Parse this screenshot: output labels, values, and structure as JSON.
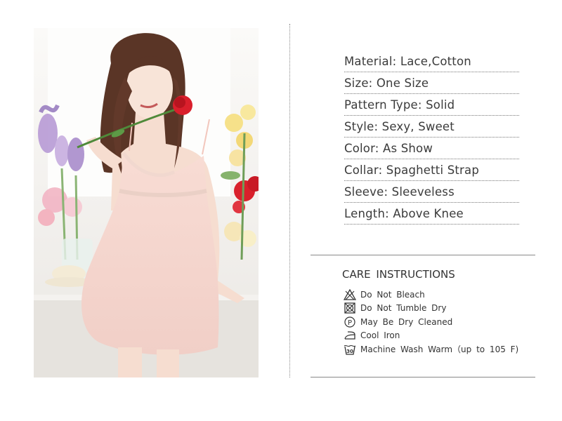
{
  "product": {
    "attributes": [
      {
        "label": "Material: Lace,Cotton"
      },
      {
        "label": "Size: One Size"
      },
      {
        "label": "Pattern Type: Solid"
      },
      {
        "label": "Style: Sexy, Sweet"
      },
      {
        "label": "Color: As Show"
      },
      {
        "label": "Collar: Spaghetti Strap"
      },
      {
        "label": "Sleeve: Sleeveless"
      },
      {
        "label": "Length: Above Knee"
      }
    ]
  },
  "care": {
    "title": "CARE  INSTRUCTIONS",
    "items": [
      {
        "icon": "no-bleach-icon",
        "label": "Do Not Bleach"
      },
      {
        "icon": "no-tumble-dry-icon",
        "label": "Do Not Tumble Dry"
      },
      {
        "icon": "dry-clean-p-icon",
        "label": "May Be Dry Cleaned",
        "glyph": "P"
      },
      {
        "icon": "iron-icon",
        "label": "Cool Iron"
      },
      {
        "icon": "wash-30-icon",
        "label": "Machine Wash Warm（up to 105 F)",
        "glyph": "30"
      }
    ]
  },
  "colors": {
    "dress": "#f6d6cf",
    "rose": "#d91f2c",
    "hair": "#5a3526"
  }
}
